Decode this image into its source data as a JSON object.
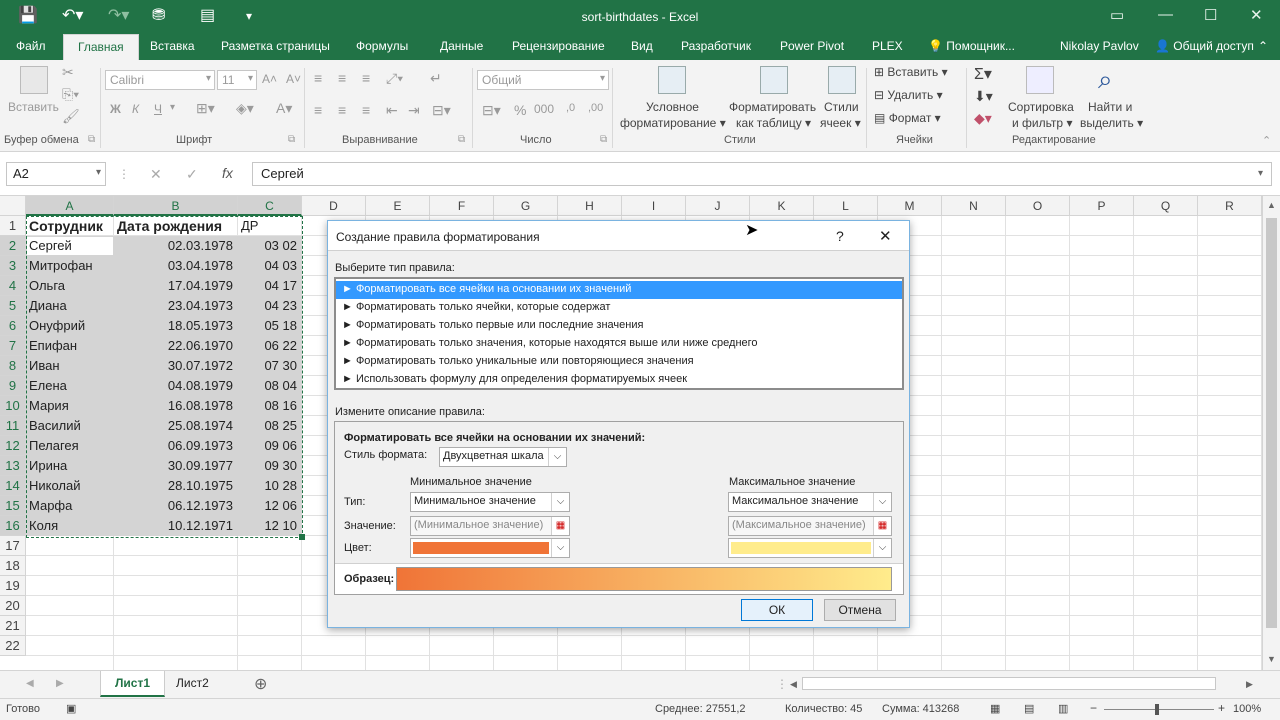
{
  "window": {
    "title": "sort-birthdates - Excel"
  },
  "tabs": {
    "file": "Файл",
    "home": "Главная",
    "insert": "Вставка",
    "layout": "Разметка страницы",
    "formulas": "Формулы",
    "data": "Данные",
    "review": "Рецензирование",
    "view": "Вид",
    "developer": "Разработчик",
    "powerpivot": "Power Pivot",
    "plex": "PLEX",
    "tellme": "Помощник...",
    "user": "Nikolay Pavlov",
    "share": "Общий доступ"
  },
  "ribbon": {
    "clipboard": {
      "paste": "Вставить",
      "group": "Буфер обмена"
    },
    "font": {
      "name": "Calibri",
      "size": "11",
      "bold": "Ж",
      "italic": "К",
      "underline": "Ч",
      "group": "Шрифт"
    },
    "align": {
      "group": "Выравнивание"
    },
    "number": {
      "format": "Общий",
      "group": "Число"
    },
    "styles": {
      "cond": "Условное",
      "cond2": "форматирование",
      "table": "Форматировать",
      "table2": "как таблицу",
      "cell": "Стили",
      "cell2": "ячеек",
      "group": "Стили"
    },
    "cells": {
      "insert": "Вставить",
      "delete": "Удалить",
      "format": "Формат",
      "group": "Ячейки"
    },
    "editing": {
      "sort": "Сортировка",
      "sort2": "и фильтр",
      "find": "Найти и",
      "find2": "выделить",
      "group": "Редактирование"
    }
  },
  "formula_bar": {
    "name_box": "A2",
    "fx": "fx",
    "content": "Сергей"
  },
  "grid": {
    "columns": [
      "A",
      "B",
      "C",
      "D",
      "E",
      "F",
      "G",
      "H",
      "I",
      "J",
      "K",
      "L",
      "M",
      "N",
      "O",
      "P",
      "Q",
      "R"
    ],
    "rows": [
      "1",
      "2",
      "3",
      "4",
      "5",
      "6",
      "7",
      "8",
      "9",
      "10",
      "11",
      "12",
      "13",
      "14",
      "15",
      "16",
      "17",
      "18",
      "19",
      "20",
      "21",
      "22"
    ],
    "headers": [
      "Сотрудник",
      "Дата рождения",
      "ДР"
    ],
    "data": [
      [
        "Сергей",
        "02.03.1978",
        "03 02"
      ],
      [
        "Митрофан",
        "03.04.1978",
        "04 03"
      ],
      [
        "Ольга",
        "17.04.1979",
        "04 17"
      ],
      [
        "Диана",
        "23.04.1973",
        "04 23"
      ],
      [
        "Онуфрий",
        "18.05.1973",
        "05 18"
      ],
      [
        "Епифан",
        "22.06.1970",
        "06 22"
      ],
      [
        "Иван",
        "30.07.1972",
        "07 30"
      ],
      [
        "Елена",
        "04.08.1979",
        "08 04"
      ],
      [
        "Мария",
        "16.08.1978",
        "08 16"
      ],
      [
        "Василий",
        "25.08.1974",
        "08 25"
      ],
      [
        "Пелагея",
        "06.09.1973",
        "09 06"
      ],
      [
        "Ирина",
        "30.09.1977",
        "09 30"
      ],
      [
        "Николай",
        "28.10.1975",
        "10 28"
      ],
      [
        "Марфа",
        "06.12.1973",
        "12 06"
      ],
      [
        "Коля",
        "10.12.1971",
        "12 10"
      ]
    ]
  },
  "sheets": {
    "active": "Лист1",
    "other": "Лист2"
  },
  "status": {
    "ready": "Готово",
    "average": "Среднее: 27551,2",
    "count": "Количество: 45",
    "sum": "Сумма: 413268",
    "zoom": "100%"
  },
  "dialog": {
    "title": "Создание правила форматирования",
    "help": "?",
    "select_label": "Выберите тип правила:",
    "rule_types": [
      "► Форматировать все ячейки на основании их значений",
      "► Форматировать только ячейки, которые содержат",
      "► Форматировать только первые или последние значения",
      "► Форматировать только значения, которые находятся выше или ниже среднего",
      "► Форматировать только уникальные или повторяющиеся значения",
      "► Использовать формулу для определения форматируемых ячеек"
    ],
    "edit_label": "Измените описание правила:",
    "section_title": "Форматировать все ячейки на основании их значений:",
    "style_label": "Стиль формата:",
    "style_value": "Двухцветная шкала",
    "min_header": "Минимальное значение",
    "max_header": "Максимальное значение",
    "type_label": "Тип:",
    "value_label": "Значение:",
    "color_label": "Цвет:",
    "min_type": "Минимальное значение",
    "max_type": "Максимальное значение",
    "min_value": "(Минимальное значение)",
    "max_value": "(Максимальное значение)",
    "min_color": "#f07437",
    "max_color": "#ffec8c",
    "preview_label": "Образец:",
    "ok": "ОК",
    "cancel": "Отмена"
  },
  "colors": {
    "excel_green": "#217346",
    "selection": "#d4d4d4"
  }
}
